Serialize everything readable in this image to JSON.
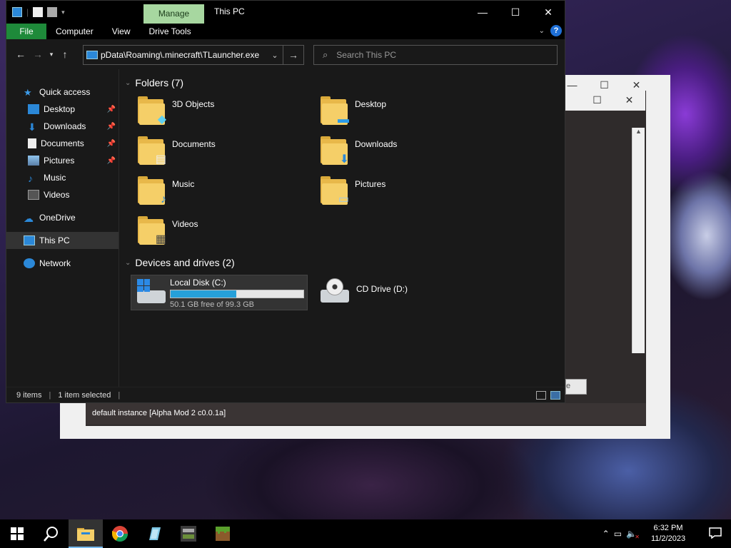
{
  "explorer": {
    "title": "This PC",
    "manage_tab": "Manage",
    "ribbon_tabs": [
      "File",
      "Computer",
      "View",
      "Drive Tools"
    ],
    "address": "pData\\Roaming\\.minecraft\\TLauncher.exe",
    "search_placeholder": "Search This PC",
    "nav": {
      "quick_access": "Quick access",
      "quick_items": [
        {
          "label": "Desktop",
          "pinned": true
        },
        {
          "label": "Downloads",
          "pinned": true
        },
        {
          "label": "Documents",
          "pinned": true
        },
        {
          "label": "Pictures",
          "pinned": true
        },
        {
          "label": "Music",
          "pinned": false
        },
        {
          "label": "Videos",
          "pinned": false
        }
      ],
      "onedrive": "OneDrive",
      "this_pc": "This PC",
      "network": "Network"
    },
    "folders_header": "Folders (7)",
    "folders": [
      "3D Objects",
      "Desktop",
      "Documents",
      "Downloads",
      "Music",
      "Pictures",
      "Videos"
    ],
    "devices_header": "Devices and drives (2)",
    "drives": [
      {
        "name": "Local Disk (C:)",
        "free": "50.1 GB free of 99.3 GB",
        "used_fraction": 0.4955
      },
      {
        "name": "CD Drive (D:)"
      }
    ],
    "status": {
      "items": "9 items",
      "selected": "1 item selected"
    }
  },
  "background_window": {
    "instance_label": "default instance [Alpha Mod 2 c0.0.1a]",
    "button_fragment": "e"
  },
  "taskbar": {
    "time": "6:32 PM",
    "date": "11/2/2023",
    "apps": [
      "start",
      "search",
      "file-explorer",
      "chrome",
      "app-blue",
      "app-minecraft-craft",
      "app-minecraft"
    ]
  },
  "colors": {
    "accent": "#76b9ed",
    "file_tab": "#1e8a3a",
    "manage_tab": "#a7d7a0",
    "drive_fill": "#26a0da"
  }
}
